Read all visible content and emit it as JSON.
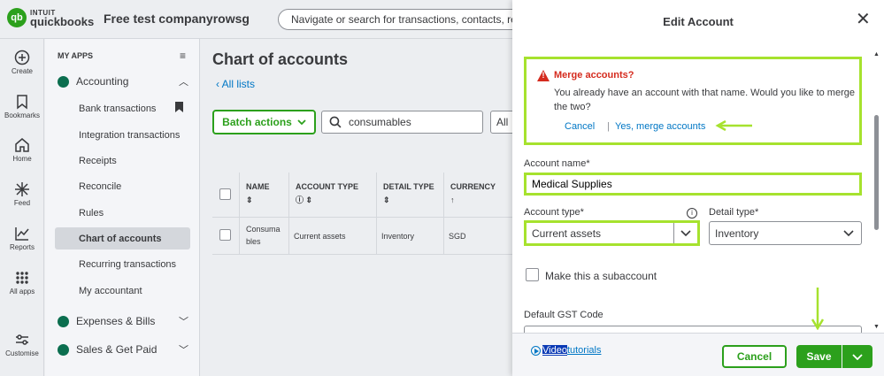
{
  "topbar": {
    "logo_top": "INTUIT",
    "logo_bottom": "quickbooks",
    "logo_mark": "qb",
    "company": "Free test companyrowsg",
    "search_placeholder": "Navigate or search for transactions, contacts, reports"
  },
  "rail": {
    "items": [
      {
        "label": "Create",
        "icon": "plus-icon"
      },
      {
        "label": "Bookmarks",
        "icon": "bookmark-icon"
      },
      {
        "label": "Home",
        "icon": "home-icon"
      },
      {
        "label": "Feed",
        "icon": "feed-icon"
      },
      {
        "label": "Reports",
        "icon": "reports-icon"
      },
      {
        "label": "All apps",
        "icon": "grid-icon"
      },
      {
        "label": "Customise",
        "icon": "sliders-icon"
      }
    ]
  },
  "nav": {
    "heading": "MY APPS",
    "accounting": "Accounting",
    "items": [
      "Bank transactions",
      "Integration transactions",
      "Receipts",
      "Reconcile",
      "Rules",
      "Chart of accounts",
      "Recurring transactions",
      "My accountant"
    ],
    "expenses": "Expenses & Bills",
    "sales": "Sales & Get Paid"
  },
  "main": {
    "title": "Chart of accounts",
    "all_lists": "All lists",
    "batch_actions": "Batch actions",
    "filter_value": "consumables",
    "all_select": "All",
    "columns": [
      "NAME",
      "ACCOUNT TYPE",
      "DETAIL TYPE",
      "CURRENCY"
    ],
    "rows": [
      {
        "name_line1": "Consuma",
        "name_line2": "bles",
        "account_type": "Current assets",
        "detail_type": "Inventory",
        "currency": "SGD"
      }
    ]
  },
  "panel": {
    "title": "Edit Account",
    "merge": {
      "title": "Merge accounts?",
      "message": "You already have an account with that name. Would you like to merge the two?",
      "cancel": "Cancel",
      "separator": "|",
      "confirm": "Yes, merge accounts"
    },
    "account_name_label": "Account name*",
    "account_name_value": "Medical Supplies",
    "account_type_label": "Account type*",
    "account_type_value": "Current assets",
    "detail_type_label": "Detail type*",
    "detail_type_value": "Inventory",
    "subaccount_label": "Make this a subaccount",
    "gst_label": "Default GST Code",
    "video_highlight": "Video",
    "video_rest": " tutorials",
    "cancel": "Cancel",
    "save": "Save"
  },
  "colors": {
    "brand_green": "#2ca01c",
    "highlight": "#a6e22e",
    "link": "#0077c5",
    "warning": "#d52b1e"
  }
}
